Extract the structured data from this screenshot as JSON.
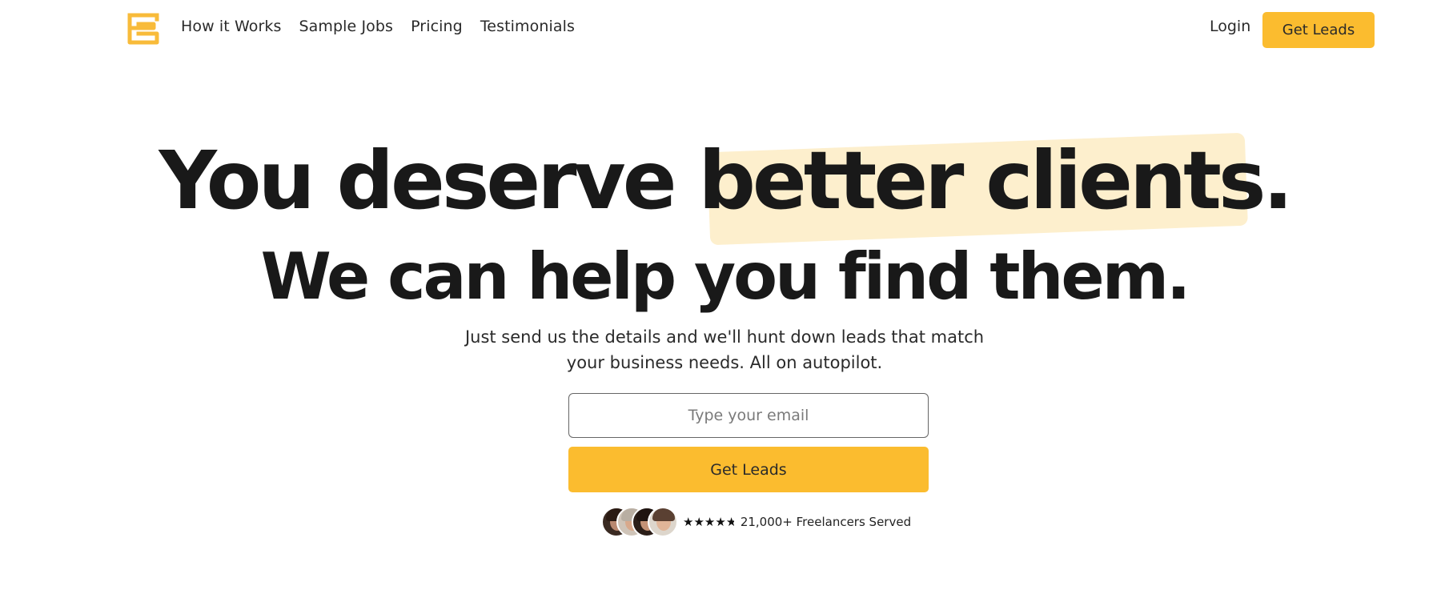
{
  "brand": {
    "logo_icon": "meander-logo-icon",
    "accent_color": "#fbbc2f",
    "highlight_color": "#fdefcd"
  },
  "nav": {
    "links": [
      {
        "label": "How it Works"
      },
      {
        "label": "Sample Jobs"
      },
      {
        "label": "Pricing"
      },
      {
        "label": "Testimonials"
      }
    ],
    "login_label": "Login",
    "cta_label": "Get Leads"
  },
  "hero": {
    "headline_plain": "You deserve ",
    "headline_highlight": "better clients.",
    "subheadline": "We can help you find them.",
    "description": "Just send us the details and we'll hunt down leads that match your business needs. All on autopilot.",
    "email_placeholder": "Type your email",
    "email_value": "",
    "cta_label": "Get Leads"
  },
  "social_proof": {
    "avatar_count": 4,
    "rating": 4.5,
    "rating_max": 5,
    "text": "21,000+ Freelancers Served"
  }
}
